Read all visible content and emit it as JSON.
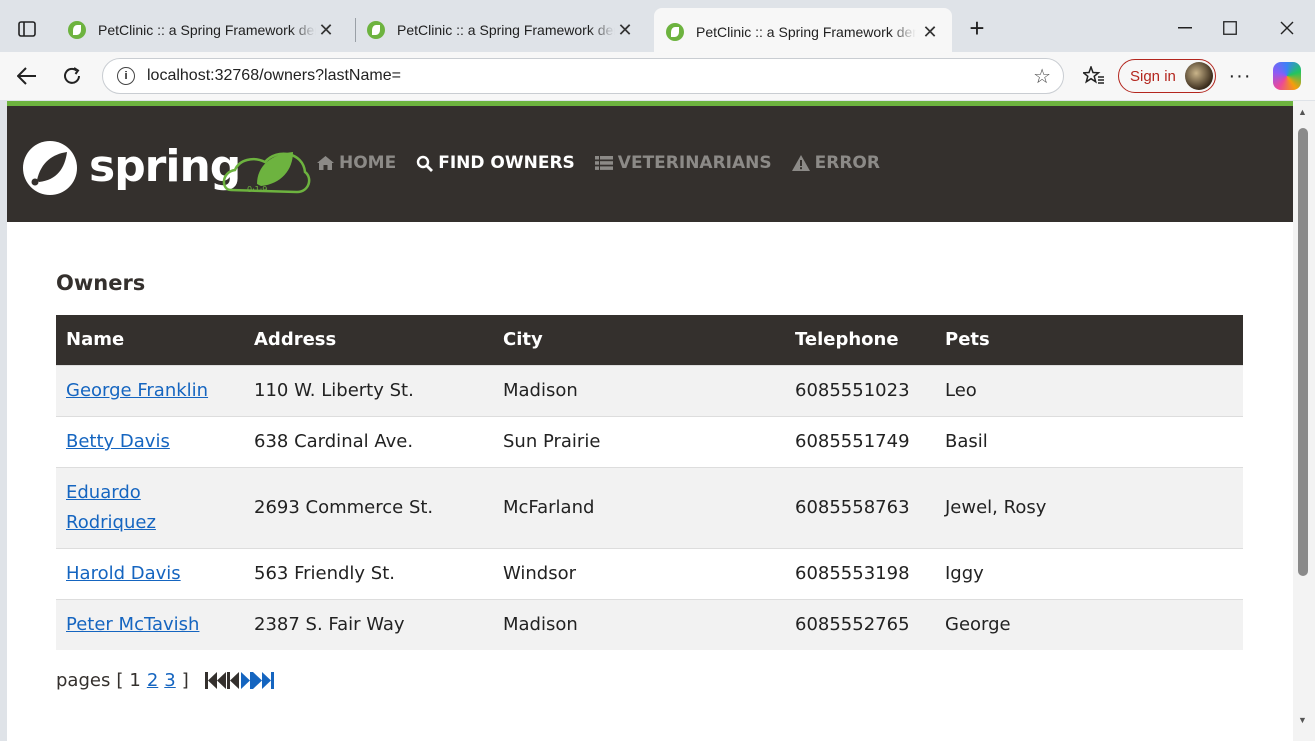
{
  "browser": {
    "tabs": [
      {
        "title": "PetClinic :: a Spring Framework demonstration",
        "active": false
      },
      {
        "title": "PetClinic :: a Spring Framework demonstration",
        "active": false
      },
      {
        "title": "PetClinic :: a Spring Framework demonstration",
        "active": true
      }
    ],
    "url": "localhost:32768/owners?lastName=",
    "signin_label": "Sign in"
  },
  "nav": {
    "items": [
      {
        "label": "HOME",
        "icon": "home-icon",
        "active": false
      },
      {
        "label": "FIND OWNERS",
        "icon": "search-icon",
        "active": true
      },
      {
        "label": "VETERINARIANS",
        "icon": "list-icon",
        "active": false
      },
      {
        "label": "ERROR",
        "icon": "warning-icon",
        "active": false
      }
    ]
  },
  "page": {
    "heading": "Owners",
    "table": {
      "columns": [
        "Name",
        "Address",
        "City",
        "Telephone",
        "Pets"
      ],
      "rows": [
        {
          "name": "George Franklin",
          "address": "110 W. Liberty St.",
          "city": "Madison",
          "telephone": "6085551023",
          "pets": "Leo"
        },
        {
          "name": "Betty Davis",
          "address": "638 Cardinal Ave.",
          "city": "Sun Prairie",
          "telephone": "6085551749",
          "pets": "Basil"
        },
        {
          "name": "Eduardo Rodriquez",
          "address": "2693 Commerce St.",
          "city": "McFarland",
          "telephone": "6085558763",
          "pets": "Jewel, Rosy"
        },
        {
          "name": "Harold Davis",
          "address": "563 Friendly St.",
          "city": "Windsor",
          "telephone": "6085553198",
          "pets": "Iggy"
        },
        {
          "name": "Peter McTavish",
          "address": "2387 S. Fair Way",
          "city": "Madison",
          "telephone": "6085552765",
          "pets": "George"
        }
      ]
    },
    "pagination": {
      "label": "pages",
      "open_bracket": "[",
      "close_bracket": "]",
      "current": "1",
      "links": [
        "2",
        "3"
      ]
    }
  },
  "colors": {
    "brand_green": "#6db33f",
    "navbar_bg": "#34302d",
    "link": "#1565c0"
  }
}
